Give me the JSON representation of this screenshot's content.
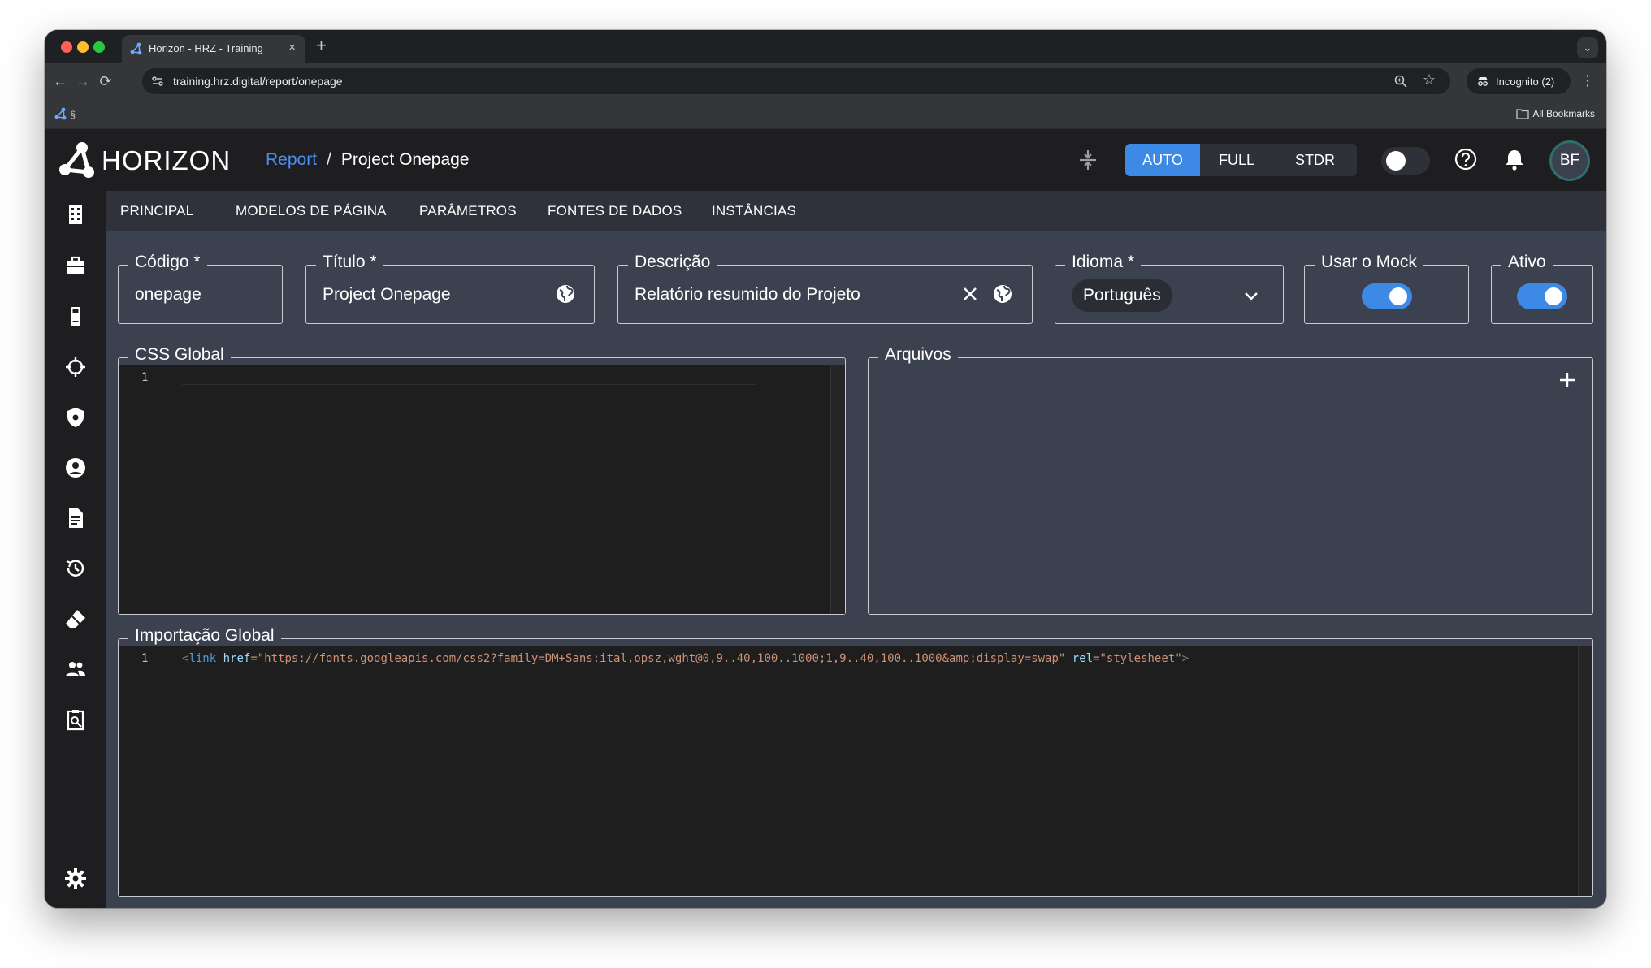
{
  "browser": {
    "tab_title": "Horizon - HRZ - Training",
    "tab_close": "×",
    "new_tab": "+",
    "url": "training.hrz.digital/report/onepage",
    "incognito": "Incognito (2)",
    "bookmark_left": "§",
    "all_bookmarks": "All Bookmarks"
  },
  "app": {
    "logo_text": "HORIZON",
    "breadcrumb": {
      "root": "Report",
      "separator": "/",
      "current": "Project Onepage"
    },
    "modes": [
      "AUTO",
      "FULL",
      "STDR"
    ],
    "active_mode": "AUTO",
    "avatar": "BF"
  },
  "subnav": [
    "PRINCIPAL",
    "MODELOS DE PÁGINA",
    "PARÂMETROS",
    "FONTES DE DADOS",
    "INSTÂNCIAS"
  ],
  "form": {
    "codigo": {
      "label": "Código *",
      "value": "onepage"
    },
    "titulo": {
      "label": "Título *",
      "value": "Project Onepage"
    },
    "descricao": {
      "label": "Descrição",
      "value": "Relatório resumido do Projeto"
    },
    "idioma": {
      "label": "Idioma *",
      "value": "Português"
    },
    "mock": {
      "label": "Usar o Mock",
      "checked": true
    },
    "ativo": {
      "label": "Ativo",
      "checked": true
    }
  },
  "css_global": {
    "label": "CSS Global",
    "line": "1",
    "code": ""
  },
  "arquivos": {
    "label": "Arquivos"
  },
  "importacao": {
    "label": "Importação Global",
    "line": "1",
    "tag_open": "<",
    "tag_name": "link",
    "attr_href": "href",
    "eq": "=\"",
    "href_value": "https://fonts.googleapis.com/css2?family=DM+Sans:ital,opsz,wght@0,9..40,100..1000;1,9..40,100..1000&amp;display=swap",
    "quote_close": "\"",
    "attr_rel": "rel",
    "rel_value": "=\"stylesheet\"",
    "tag_close": ">"
  },
  "colors": {
    "accent": "#3c8ae6",
    "app_bg": "#3c4150",
    "bar_bg": "#1e1e21",
    "editor_bg": "#1e1e1e"
  }
}
